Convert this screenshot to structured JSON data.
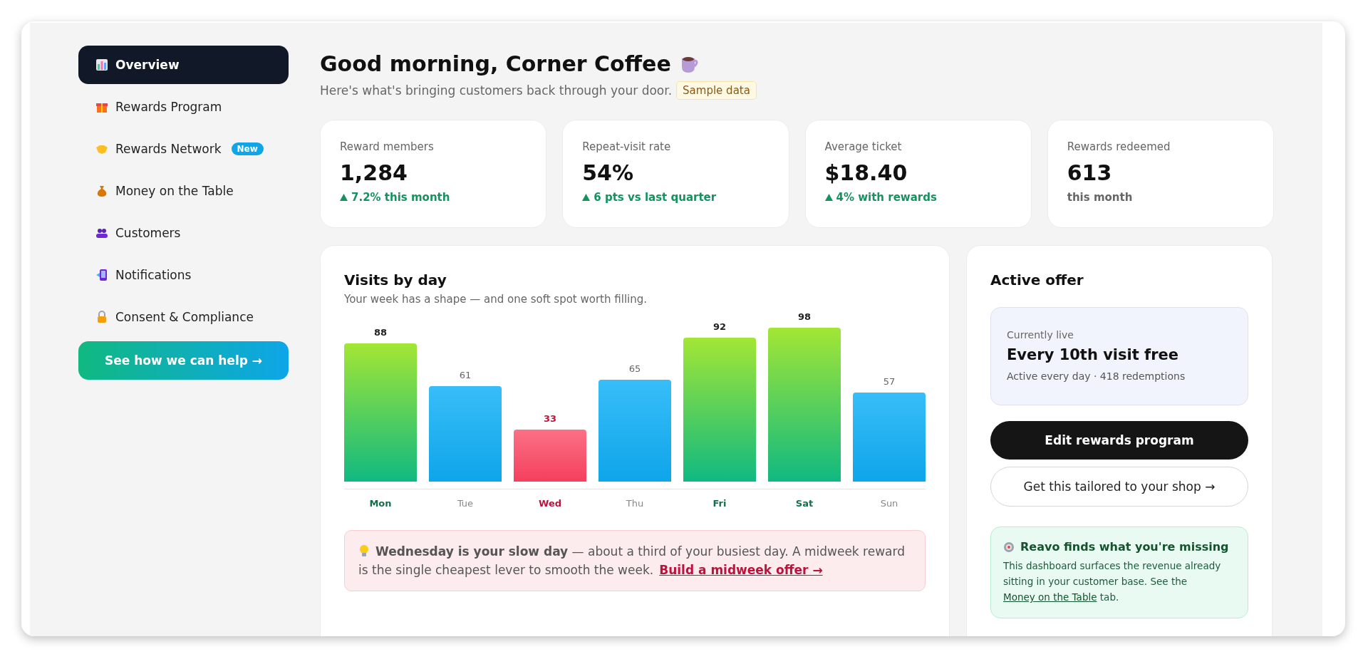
{
  "sidebar": {
    "items": [
      {
        "label": "Overview",
        "selected": true
      },
      {
        "label": "Rewards Program",
        "selected": false
      },
      {
        "label": "Rewards Network",
        "selected": false,
        "badge": "New"
      },
      {
        "label": "Money on the Table",
        "selected": false
      },
      {
        "label": "Customers",
        "selected": false
      },
      {
        "label": "Notifications",
        "selected": false
      },
      {
        "label": "Consent & Compliance",
        "selected": false
      }
    ],
    "cta": "See how we can help →"
  },
  "header": {
    "title": "Good morning, Corner Coffee",
    "subtitle": "Here's what's bringing customers back through your door.",
    "tag": "Sample data"
  },
  "stats": [
    {
      "label": "Reward members",
      "value": "1,284",
      "note": "7.2% this month",
      "kind": "rise"
    },
    {
      "label": "Repeat-visit rate",
      "value": "54%",
      "note": "6 pts vs last quarter",
      "kind": "rise"
    },
    {
      "label": "Average ticket",
      "value": "$18.40",
      "note": "4% with rewards",
      "kind": "rise"
    },
    {
      "label": "Rewards redeemed",
      "value": "613",
      "note": "this month",
      "kind": "plain"
    }
  ],
  "visits": {
    "title": "Visits by day",
    "subtitle": "Your week has a shape — and one soft spot worth filling.",
    "bars": [
      {
        "kind": "high"
      },
      {
        "kind": "mid"
      },
      {
        "kind": "low"
      },
      {
        "kind": "mid"
      },
      {
        "kind": "high"
      },
      {
        "kind": "high"
      },
      {
        "kind": "mid"
      }
    ],
    "chart_data": {
      "type": "bar",
      "categories": [
        "Mon",
        "Tue",
        "Wed",
        "Thu",
        "Fri",
        "Sat",
        "Sun"
      ],
      "values": [
        88,
        61,
        33,
        65,
        92,
        98,
        57
      ],
      "data_labels": true
    },
    "alert": {
      "text": "**Wednesday is your slow day** — about a third of your busiest day. A midweek reward is the single cheapest lever to smooth the week.",
      "link": "Build a midweek offer →"
    }
  },
  "offer": {
    "title": "Active offer",
    "status": "Currently live",
    "name": "Every 10th visit free",
    "meta": "Active every day · 418 redemptions",
    "primary_button": "Edit rewards program",
    "secondary_button": "Get this tailored to your shop →",
    "tip": {
      "title": "Reavo finds what you're missing",
      "body": "This dashboard surfaces the revenue already sitting in your customer base. See the",
      "link": "Money on the Table",
      "after": "tab."
    }
  }
}
